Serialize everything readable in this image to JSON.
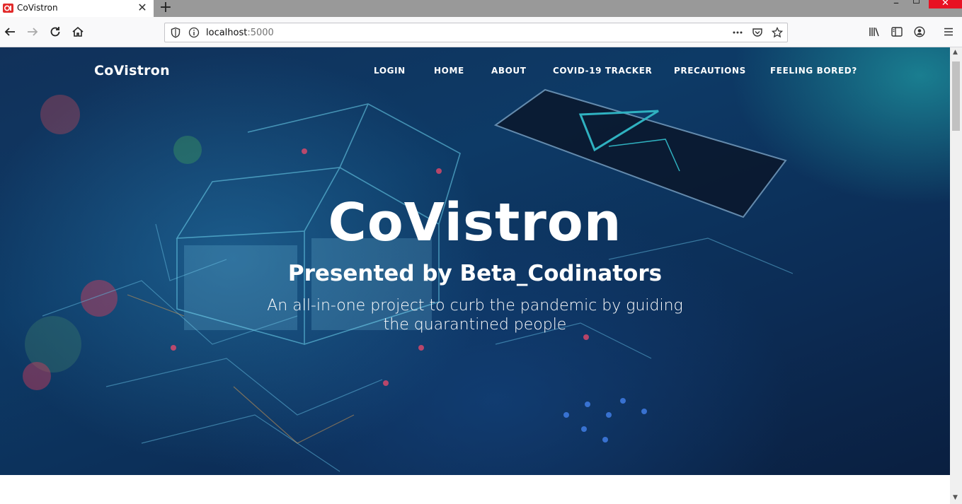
{
  "browser": {
    "tab_title": "CoVistron",
    "tab_close": "✕",
    "new_tab": "+",
    "url_host": "localhost",
    "url_port": ":5000",
    "window_min": "–",
    "window_close": "✕"
  },
  "site": {
    "brand": "CoVistron",
    "nav": [
      "LOGIN",
      "HOME",
      "ABOUT",
      "COVID-19 TRACKER",
      "PRECAUTIONS",
      "FEELING BORED?"
    ],
    "hero_title": "CoVistron",
    "hero_subtitle": "Presented by Beta_Codinators",
    "hero_description": "An all-in-one project to curb the pandemic by guiding the quarantined people"
  },
  "colors": {
    "hero_bg": "#0d3a66",
    "accent_teal": "#1e96a0",
    "text": "#ffffff",
    "close_red": "#e81123"
  },
  "icons": [
    "favicon-icon",
    "back-icon",
    "forward-icon",
    "reload-icon",
    "home-icon",
    "shield-icon",
    "info-icon",
    "more-icon",
    "pocket-icon",
    "star-icon",
    "library-icon",
    "sidebar-icon",
    "account-icon",
    "menu-icon"
  ]
}
